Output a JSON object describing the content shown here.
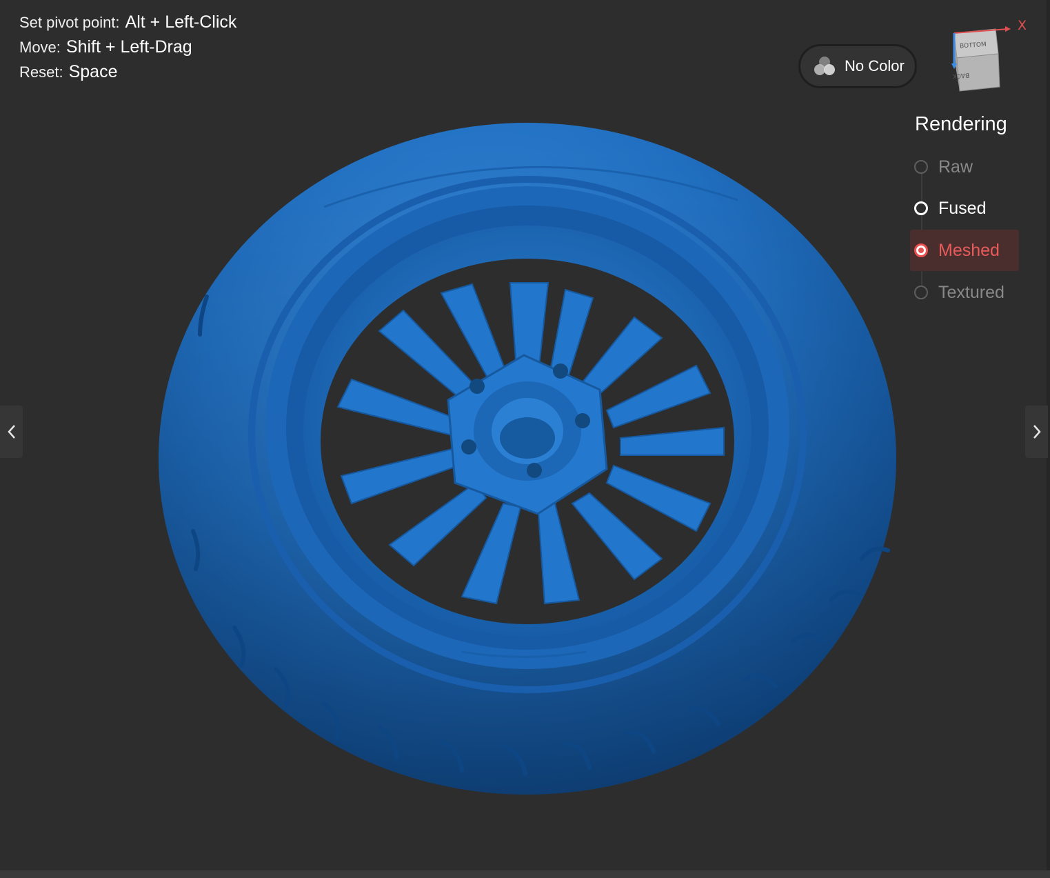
{
  "hints": [
    {
      "label": "Set pivot point:",
      "keys": "Alt + Left-Click"
    },
    {
      "label": "Move:",
      "keys": "Shift + Left-Drag"
    },
    {
      "label": "Reset:",
      "keys": "Space"
    }
  ],
  "color_button": {
    "label": "No Color",
    "icon": "color-circles-icon"
  },
  "view_cube": {
    "axis_label": "X",
    "top_face": "BOTTOM",
    "front_face": "BACK"
  },
  "rendering": {
    "title": "Rendering",
    "options": [
      {
        "label": "Raw",
        "state": "disabled"
      },
      {
        "label": "Fused",
        "state": "enabled"
      },
      {
        "label": "Meshed",
        "state": "selected"
      },
      {
        "label": "Textured",
        "state": "disabled"
      }
    ]
  },
  "nav": {
    "prev_icon": "chevron-left-icon",
    "next_icon": "chevron-right-icon"
  },
  "colors": {
    "background": "#2d2d2d",
    "model": "#1f6fc4",
    "accent": "#e85050"
  }
}
